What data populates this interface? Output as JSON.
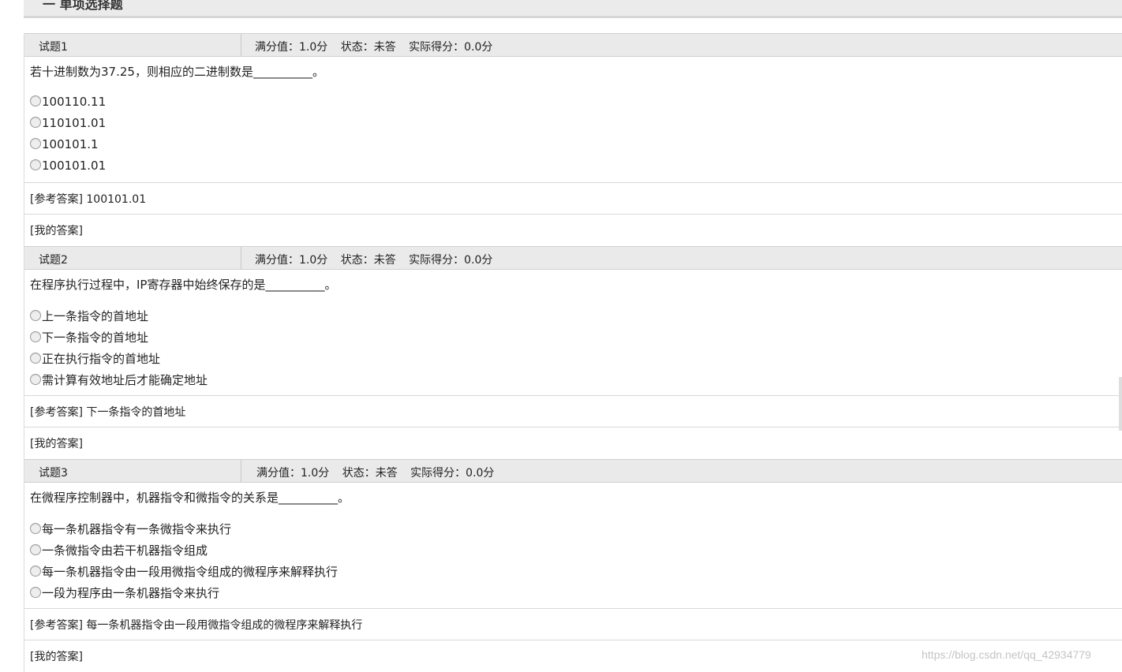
{
  "section": {
    "title": "一 单项选择题"
  },
  "labels": {
    "full_score_label": "满分值：",
    "status_label": "状态：",
    "score_label": "实际得分：",
    "ref_answer_label": "[参考答案]",
    "my_answer_label": "[我的答案]"
  },
  "questions": [
    {
      "number": "试题1",
      "full_score": "1.0分",
      "status": "未答",
      "score": "0.0分",
      "stem": "若十进制数为37.25，则相应的二进制数是__________。",
      "options": [
        "100110.11",
        "110101.01",
        "100101.1",
        "100101.01"
      ],
      "ref_answer": "100101.01",
      "my_answer": ""
    },
    {
      "number": "试题2",
      "full_score": "1.0分",
      "status": "未答",
      "score": "0.0分",
      "stem": "在程序执行过程中，IP寄存器中始终保存的是__________。",
      "options": [
        "上一条指令的首地址",
        "下一条指令的首地址",
        "正在执行指令的首地址",
        "需计算有效地址后才能确定地址"
      ],
      "ref_answer": "下一条指令的首地址",
      "my_answer": ""
    },
    {
      "number": "试题3",
      "full_score": "1.0分",
      "status": "未答",
      "score": "0.0分",
      "stem": "在微程序控制器中，机器指令和微指令的关系是__________。",
      "options": [
        "每一条机器指令有一条微指令来执行",
        "一条微指令由若干机器指令组成",
        "每一条机器指令由一段用微指令组成的微程序来解释执行",
        "一段为程序由一条机器指令来执行"
      ],
      "ref_answer": "每一条机器指令由一段用微指令组成的微程序来解释执行",
      "my_answer": ""
    }
  ],
  "watermark": "https://blog.csdn.net/qq_42934779"
}
